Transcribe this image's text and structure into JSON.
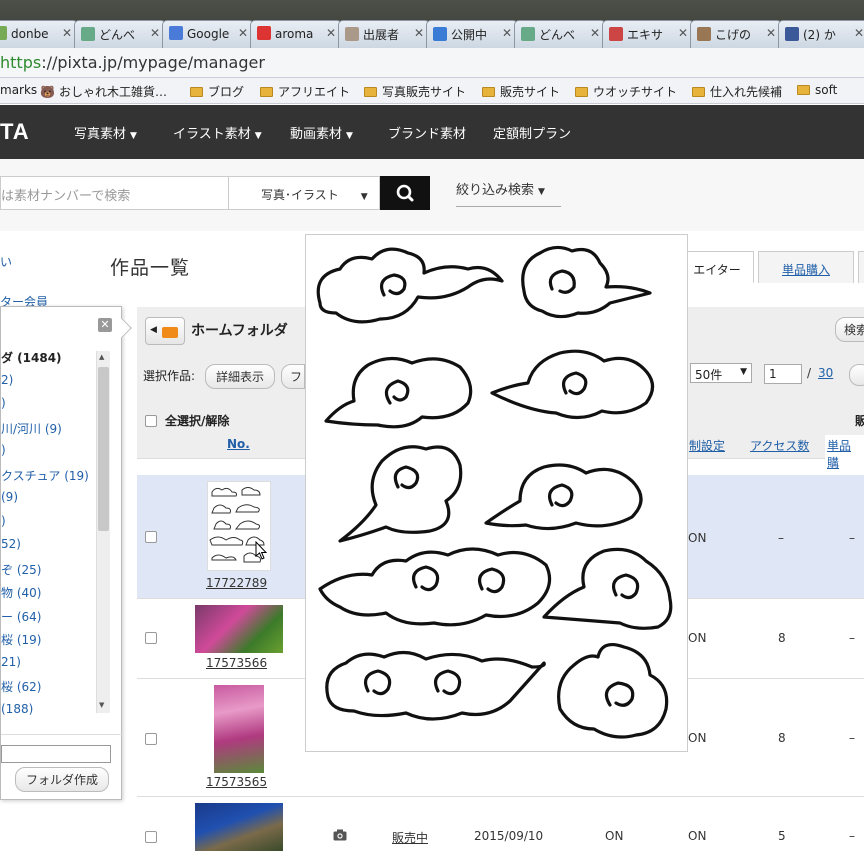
{
  "browser": {
    "tabs": [
      {
        "label": "donbe",
        "color": "#7a5"
      },
      {
        "label": "どんべ",
        "color": "#6a8"
      },
      {
        "label": "Google",
        "color": "#4a7bd8"
      },
      {
        "label": "aroma",
        "color": "#d33"
      },
      {
        "label": "出展者",
        "color": "#a98"
      },
      {
        "label": "公開中",
        "color": "#3a7bd5"
      },
      {
        "label": "どんべ",
        "color": "#6a8"
      },
      {
        "label": "エキサ",
        "color": "#c44"
      },
      {
        "label": "こげの",
        "color": "#975"
      },
      {
        "label": "(2) か",
        "color": "#3b5998"
      }
    ],
    "url_scheme": "https",
    "url_rest": "://pixta.jp/mypage/manager",
    "bookmarks": [
      "marks",
      "おしゃれ木工雑貨…",
      "ブログ",
      "アフリエイト",
      "写真販売サイト",
      "販売サイト",
      "ウオッチサイト",
      "仕入れ先候補",
      "soft"
    ]
  },
  "site": {
    "logo": "TA",
    "nav": [
      "写真素材",
      "イラスト素材",
      "動画素材",
      "ブランド素材",
      "定額制プラン"
    ],
    "search_placeholder": "は素材ナンバーで検索",
    "search_type": "写真･イラスト",
    "filter": "絞り込み検索"
  },
  "page": {
    "title": "作品一覧",
    "left_links": [
      "い",
      "ター会員"
    ],
    "tabs": [
      "エイター",
      "単品購入"
    ],
    "folder_name": "ホームフォルダ",
    "search_button": "検索",
    "selected_label": "選択作品:",
    "detail_button": "詳細表示",
    "next_button": "フ",
    "per_page": "50件",
    "page_current": "1",
    "page_total": "30",
    "select_all": "全選択/解除",
    "col_no": "No.",
    "col_setting": "制設定",
    "col_access": "アクセス数",
    "col_single": "単品購",
    "col_sale": "販"
  },
  "rows": [
    {
      "id": "17722789",
      "status_col": "ON",
      "access": "–",
      "dash": "–"
    },
    {
      "id": "17573566",
      "status_col": "ON",
      "access": "8",
      "dash": "–"
    },
    {
      "id": "17573565",
      "status_col": "ON",
      "access": "8",
      "dash": "–"
    },
    {
      "id": "",
      "sale": "販売中",
      "date": "2015/09/10",
      "on1": "ON",
      "status_col": "ON",
      "access": "5",
      "dash": "–"
    }
  ],
  "popup": {
    "items": [
      {
        "label": "ダ (1484)",
        "bold": true
      },
      {
        "label": "2)"
      },
      {
        "label": ")"
      },
      {
        "label": "川/河川 (9)"
      },
      {
        "label": ")"
      },
      {
        "label": "クスチュア (19)"
      },
      {
        "label": "(9)"
      },
      {
        "label": ")"
      },
      {
        "label": "52)"
      },
      {
        "label": "ぞ (25)"
      },
      {
        "label": "物 (40)"
      },
      {
        "label": "ー (64)"
      },
      {
        "label": "桜 (19)"
      },
      {
        "label": "21)"
      },
      {
        "label": "桜 (62)"
      },
      {
        "label": "(188)"
      }
    ],
    "create_button": "フォルダ作成"
  }
}
